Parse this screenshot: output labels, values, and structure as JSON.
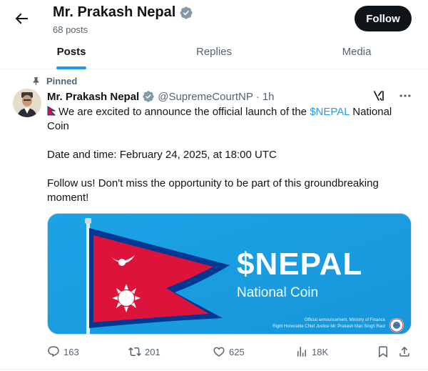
{
  "header": {
    "title": "Mr. Prakash Nepal",
    "posts_count": "68 posts",
    "follow_label": "Follow"
  },
  "tabs": [
    {
      "label": "Posts"
    },
    {
      "label": "Replies"
    },
    {
      "label": "Media"
    }
  ],
  "pinned_label": "Pinned",
  "post": {
    "name": "Mr. Prakash Nepal",
    "handle": "@SupremeCourtNP",
    "separator": "·",
    "time": "1h",
    "line1_pre": "We are excited to announce the official launch of the",
    "hashtag": "$NEPAL",
    "line1_post": "National Coin",
    "line2": "Date and time: February 24, 2025, at 18:00 UTC",
    "line3": "Follow us! Don't miss the opportunity to be part of this groundbreaking moment!"
  },
  "media": {
    "title": "$NEPAL",
    "subtitle": "National Coin",
    "fine_print_1": "Official announcement, Ministry of Finance",
    "fine_print_2": "Right Honorable Chief Justice Mr. Prakash Man Singh Raut"
  },
  "actions": {
    "replies": "163",
    "reposts": "201",
    "likes": "625",
    "views": "18K"
  },
  "colors": {
    "accent": "#1d9bf0",
    "verified": "#829aab",
    "media_bg": "#19a6e9",
    "flag_red": "#dc143c",
    "flag_blue": "#003893"
  }
}
